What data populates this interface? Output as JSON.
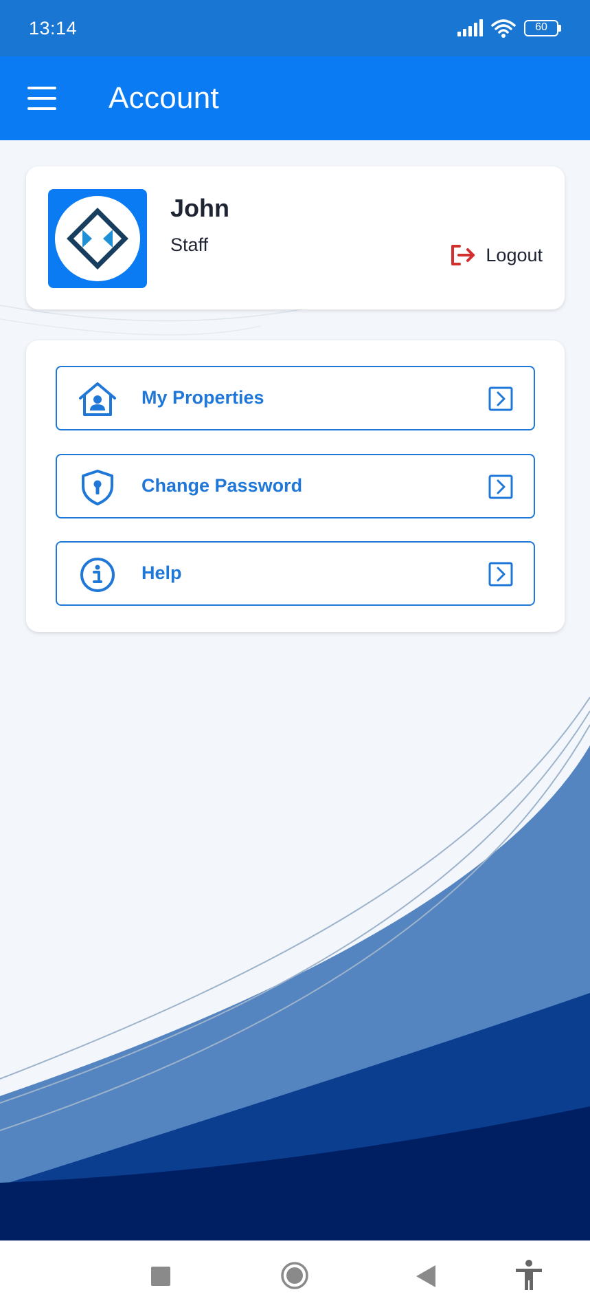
{
  "status_bar": {
    "time": "13:14",
    "battery": "60"
  },
  "app_bar": {
    "title": "Account",
    "menu_icon": "hamburger-menu-icon"
  },
  "profile": {
    "name": "John",
    "role": "Staff",
    "logout_label": "Logout",
    "logout_color": "#d32f2f",
    "avatar_icon": "company-logo"
  },
  "menu": {
    "items": [
      {
        "label": "My Properties",
        "icon": "house-user-icon"
      },
      {
        "label": "Change Password",
        "icon": "shield-keyhole-icon"
      },
      {
        "label": "Help",
        "icon": "info-circle-icon"
      }
    ]
  },
  "nav_bar": {
    "buttons": [
      "recents-square-icon",
      "home-circle-icon",
      "back-triangle-icon",
      "accessibility-icon"
    ]
  },
  "colors": {
    "primary": "#0a7bf2",
    "status_bar": "#1976d2",
    "accent_text": "#1f78d8",
    "wave_dark": "#001f63"
  }
}
